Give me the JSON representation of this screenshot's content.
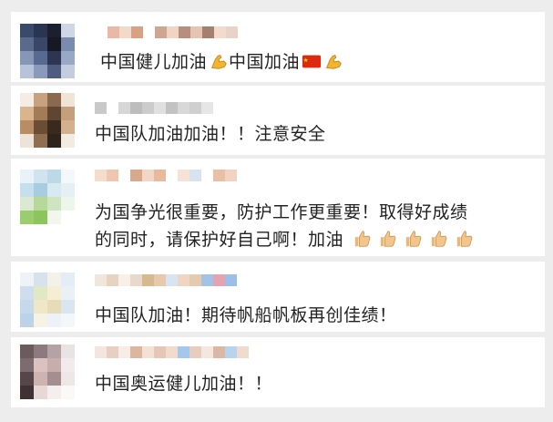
{
  "comments": [
    {
      "text": "中国健儿加油",
      "text2": "中国加油"
    },
    {
      "text": "中国队加油加油！！注意安全"
    },
    {
      "line1": "为国争光很重要，防护工作更重要！取得好成绩",
      "line2": "的同时，请保护好自己啊！加油"
    },
    {
      "text": "中国队加油！期待帆船帆板再创佳绩！"
    },
    {
      "text": "中国奥运健儿加油！！"
    }
  ],
  "icons": {
    "muscle": "flexed-biceps-icon",
    "flag": "china-flag-icon",
    "thumbs": "thumbs-up-icon"
  }
}
